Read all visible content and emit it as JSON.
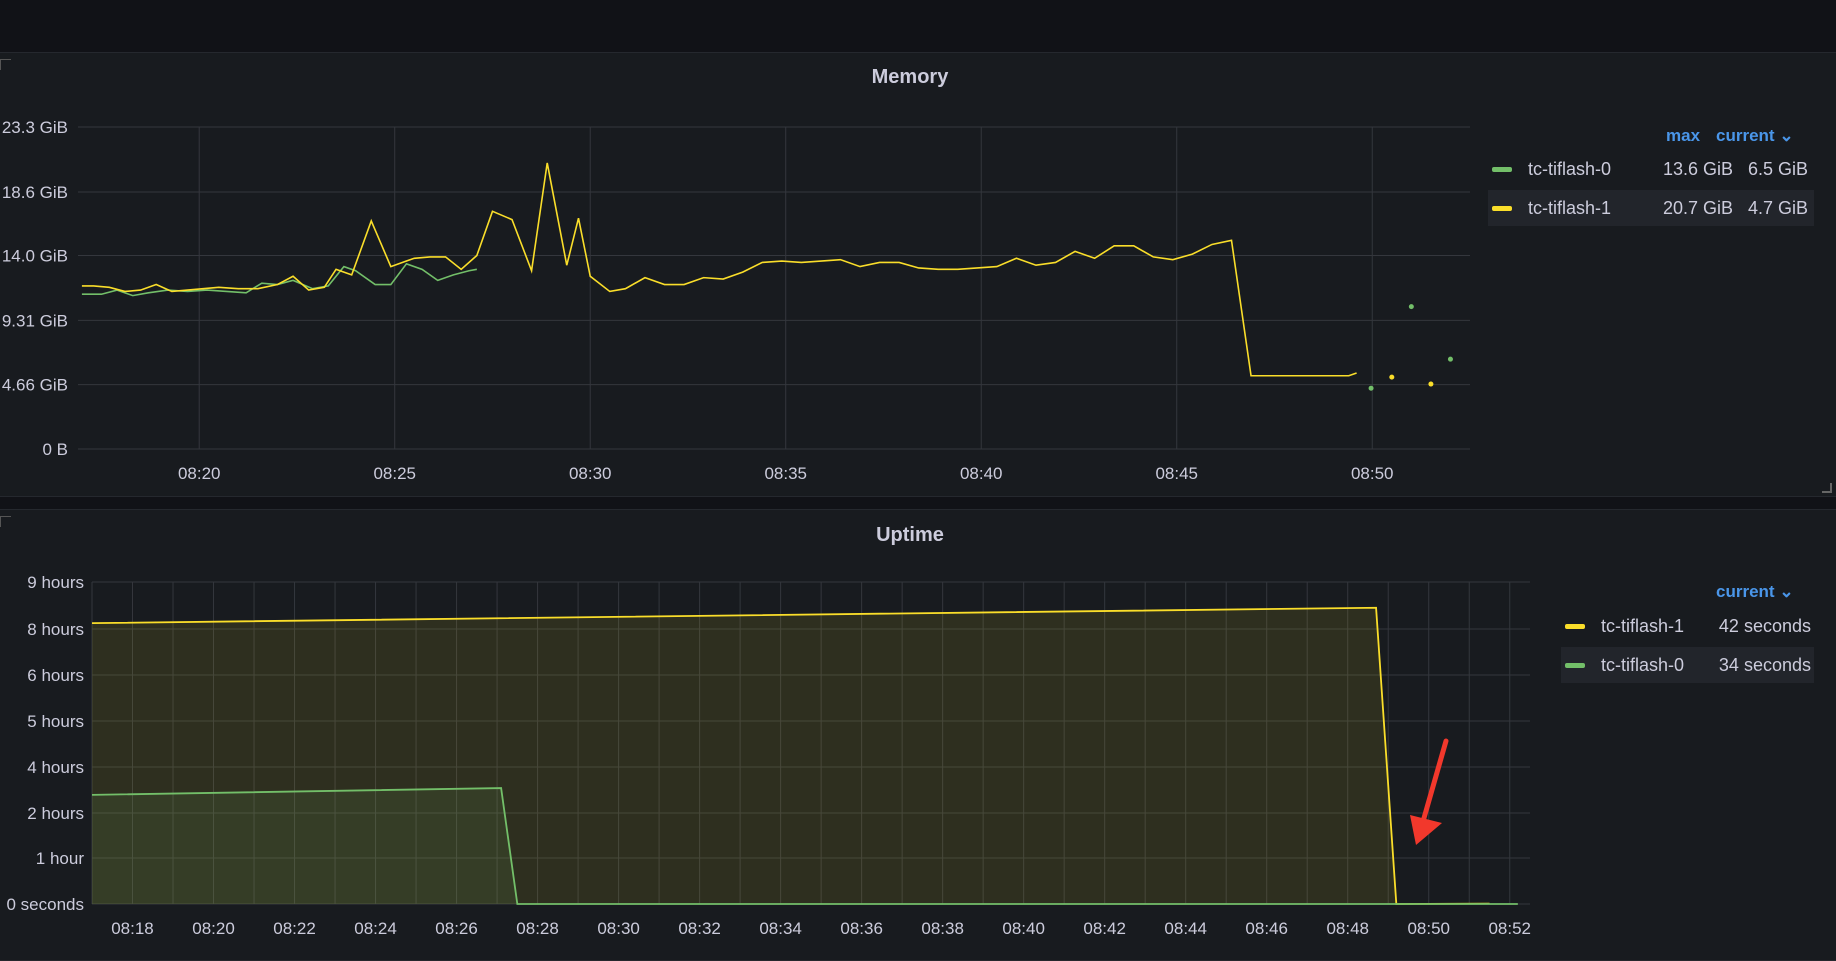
{
  "colors": {
    "green": "#73bf69",
    "yellow": "#fade2a",
    "grid": "#34373d",
    "arrow": "#f2382c",
    "accent": "#4a96e9"
  },
  "chart_data": [
    {
      "type": "line",
      "title": "Memory",
      "y_ticks": [
        "0 B",
        "4.66 GiB",
        "9.31 GiB",
        "14.0 GiB",
        "18.6 GiB",
        "23.3 GiB"
      ],
      "y_tick_values": [
        0,
        4.66,
        9.31,
        14.0,
        18.6,
        23.3
      ],
      "ylim": [
        0,
        23.3
      ],
      "x_ticks": [
        "08:20",
        "08:25",
        "08:30",
        "08:35",
        "08:40",
        "08:45",
        "08:50"
      ],
      "x_tick_values": [
        20,
        25,
        30,
        35,
        40,
        45,
        50
      ],
      "xlim": [
        16.9,
        52.5
      ],
      "grid": true,
      "legend_placement": "right",
      "legend": {
        "columns": [
          "max",
          "current"
        ],
        "rows": [
          {
            "name": "tc-tiflash-0",
            "color": "#73bf69",
            "max": "13.6 GiB",
            "current": "6.5 GiB"
          },
          {
            "name": "tc-tiflash-1",
            "color": "#fade2a",
            "max": "20.7 GiB",
            "current": "4.7 GiB"
          }
        ]
      },
      "series": [
        {
          "name": "tc-tiflash-0",
          "color": "#73bf69",
          "x": [
            17.0,
            17.5,
            17.9,
            18.3,
            18.7,
            19.2,
            19.7,
            20.2,
            20.7,
            21.2,
            21.6,
            22.0,
            22.4,
            22.9,
            23.3,
            23.7,
            24.0,
            24.5,
            24.9,
            25.3,
            25.7,
            26.1,
            26.5,
            26.9,
            27.1
          ],
          "y": [
            11.2,
            11.2,
            11.5,
            11.1,
            11.3,
            11.5,
            11.4,
            11.5,
            11.4,
            11.3,
            12.0,
            11.9,
            12.2,
            11.6,
            11.8,
            13.2,
            12.9,
            11.9,
            11.9,
            13.4,
            13.0,
            12.2,
            12.6,
            12.9,
            13.0
          ],
          "points": [
            [
              49.97,
              4.4
            ],
            [
              51.0,
              10.3
            ],
            [
              52.0,
              6.5
            ]
          ]
        },
        {
          "name": "tc-tiflash-1",
          "color": "#fade2a",
          "x": [
            17.0,
            17.3,
            17.7,
            18.1,
            18.5,
            18.9,
            19.3,
            19.7,
            20.1,
            20.5,
            21.0,
            21.5,
            22.0,
            22.4,
            22.8,
            23.2,
            23.5,
            23.9,
            24.4,
            24.9,
            25.3,
            25.5,
            25.9,
            26.3,
            26.7,
            27.1,
            27.5,
            28.0,
            28.5,
            28.9,
            29.4,
            29.7,
            30.0,
            30.5,
            30.9,
            31.4,
            31.9,
            32.4,
            32.9,
            33.4,
            33.9,
            34.4,
            34.9,
            35.4,
            35.9,
            36.4,
            36.9,
            37.4,
            37.9,
            38.4,
            38.9,
            39.4,
            39.9,
            40.4,
            40.9,
            41.4,
            41.9,
            42.4,
            42.9,
            43.4,
            43.9,
            44.4,
            44.9,
            45.4,
            45.9,
            46.4,
            46.9,
            47.4,
            47.9,
            48.4,
            48.9,
            49.4,
            49.6
          ],
          "y": [
            11.8,
            11.8,
            11.7,
            11.4,
            11.5,
            11.9,
            11.4,
            11.5,
            11.6,
            11.7,
            11.6,
            11.6,
            11.9,
            12.5,
            11.5,
            11.7,
            13.0,
            12.6,
            16.5,
            13.2,
            13.6,
            13.8,
            13.9,
            13.9,
            13.0,
            14.0,
            17.2,
            16.6,
            12.9,
            20.7,
            13.3,
            16.7,
            12.5,
            11.4,
            11.6,
            12.4,
            11.9,
            11.9,
            12.4,
            12.3,
            12.8,
            13.5,
            13.6,
            13.5,
            13.6,
            13.7,
            13.2,
            13.5,
            13.5,
            13.1,
            13.0,
            13.0,
            13.1,
            13.2,
            13.8,
            13.3,
            13.5,
            14.3,
            13.8,
            14.7,
            14.7,
            13.9,
            13.7,
            14.1,
            14.8,
            15.1,
            5.3,
            5.3,
            5.3,
            5.3,
            5.3,
            5.3,
            5.5
          ],
          "points": [
            [
              50.5,
              5.2
            ],
            [
              51.5,
              4.7
            ]
          ]
        }
      ]
    },
    {
      "type": "area",
      "title": "Uptime",
      "y_ticks": [
        "0 seconds",
        "1 hour",
        "2 hours",
        "4 hours",
        "5 hours",
        "6 hours",
        "8 hours",
        "9 hours"
      ],
      "x_ticks": [
        "08:18",
        "08:20",
        "08:22",
        "08:24",
        "08:26",
        "08:28",
        "08:30",
        "08:32",
        "08:34",
        "08:36",
        "08:38",
        "08:40",
        "08:42",
        "08:44",
        "08:46",
        "08:48",
        "08:50",
        "08:52"
      ],
      "x_tick_values": [
        18,
        20,
        22,
        24,
        26,
        28,
        30,
        32,
        34,
        36,
        38,
        40,
        42,
        44,
        46,
        48,
        50,
        52
      ],
      "xlim": [
        17.0,
        52.5
      ],
      "grid": true,
      "legend_placement": "right",
      "legend": {
        "columns": [
          "current"
        ],
        "rows": [
          {
            "name": "tc-tiflash-1",
            "color": "#fade2a",
            "current": "42 seconds"
          },
          {
            "name": "tc-tiflash-0",
            "color": "#73bf69",
            "current": "34 seconds"
          }
        ]
      },
      "series": [
        {
          "name": "tc-tiflash-1",
          "color": "#fade2a",
          "x": [
            17.0,
            48.7,
            49.2,
            51.5
          ],
          "y": [
            7.85,
            8.28,
            0.0,
            0.01
          ]
        },
        {
          "name": "tc-tiflash-0",
          "color": "#73bf69",
          "x": [
            17.0,
            27.1,
            27.5,
            52.2
          ],
          "y": [
            3.05,
            3.24,
            0.0,
            0.0
          ]
        }
      ],
      "annotation": "red arrow pointing to the drop near 08:49"
    }
  ]
}
